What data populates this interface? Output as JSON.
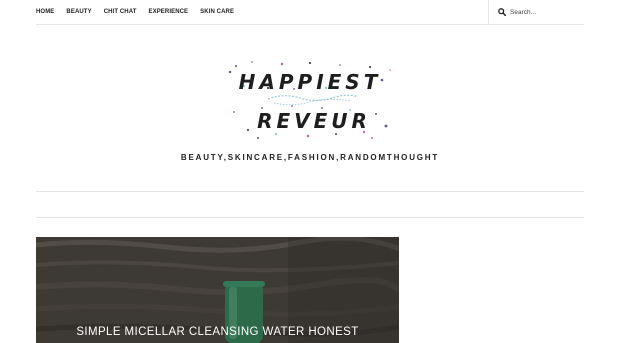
{
  "nav": {
    "items": [
      {
        "label": "HOME"
      },
      {
        "label": "BEAUTY"
      },
      {
        "label": "CHIT CHAT"
      },
      {
        "label": "EXPERIENCE"
      },
      {
        "label": "SKIN CARE"
      }
    ]
  },
  "search": {
    "placeholder": "Search..."
  },
  "logo": {
    "line1": "HAPPIEST",
    "line2": "REVEUR"
  },
  "tagline": "BEAUTY,SKINCARE,FASHION,RANDOMTHOUGHT",
  "featured": {
    "title": "SIMPLE MICELLAR CLEANSING WATER HONEST"
  },
  "colors": {
    "text": "#222222",
    "divider": "#e4e4e4",
    "logo_accent": "#8fc7d6"
  }
}
